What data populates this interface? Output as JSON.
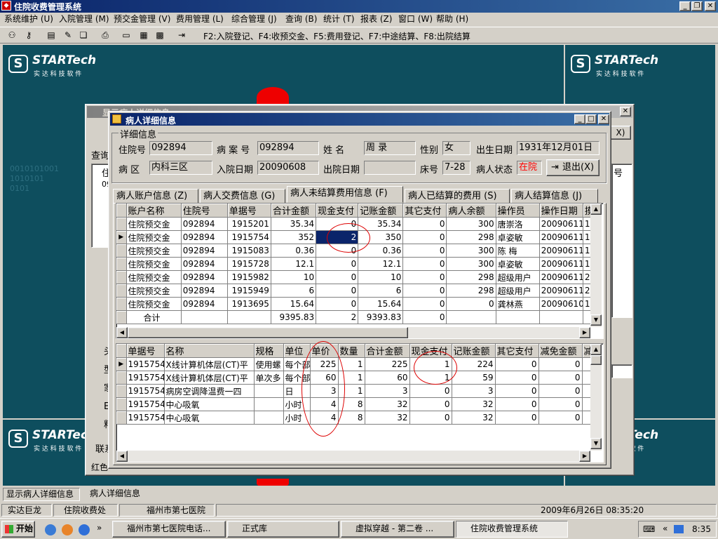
{
  "app": {
    "title": "住院收费管理系统",
    "menu": [
      "系统维护 (U)",
      "入院管理 (M)",
      "预交金管理 (V)",
      "费用管理 (L)",
      "综合管理 (J)",
      "查询 (B)",
      "统计 (T)",
      "报表 (Z)",
      "窗口 (W)",
      "帮助 (H)"
    ],
    "shortcuts": "F2:入院登记、F4:收预交金、F5:费用登记、F7:中途结算、F8:出院结算",
    "logo_text": "STARTech",
    "logo_sub": "实 达 科 技 软 件"
  },
  "back_dialog": {
    "title": "显示病人详细信息",
    "query_label": "查询",
    "col1": "住",
    "row1": "09",
    "left_labels": [
      "头",
      "型",
      "家",
      "E",
      "料",
      "联系"
    ],
    "footer": "红色",
    "close_hint": "X)",
    "right_col": "号"
  },
  "dialog": {
    "title": "病人详细信息",
    "group_label": "详细信息",
    "fields": {
      "inpatient_no_label": "住院号",
      "inpatient_no": "092894",
      "case_no_label": "病 案 号",
      "case_no": "092894",
      "name_label": "姓    名",
      "name": "周  录",
      "sex_label": "性别",
      "sex": "女",
      "birth_label": "出生日期",
      "birth": "1931年12月01日",
      "ward_label": "病  区",
      "ward": "内科三区",
      "admit_label": "入院日期",
      "admit": "20090608",
      "discharge_label": "出院日期",
      "discharge": "",
      "bed_label": "床号",
      "bed": "7-28",
      "status_label": "病人状态",
      "status": "在院",
      "exit_button": "退出(X)"
    },
    "tabs": [
      "病人账户信息 (Z)",
      "病人交费信息 (G)",
      "病人未结算费用信息 (F)",
      "病人已结算的费用 (S)",
      "病人结算信息 (J)"
    ],
    "grid1": {
      "headers": [
        "账户名称",
        "住院号",
        "单据号",
        "合计金额",
        "现金支付",
        "记账金额",
        "其它支付",
        "病人余额",
        "操作员",
        "操作日期",
        "摸"
      ],
      "rows": [
        [
          "住院预交金",
          "092894",
          "1915201",
          "35.34",
          "0",
          "35.34",
          "0",
          "300",
          "唐崇洛",
          "20090611",
          "1:"
        ],
        [
          "住院预交金",
          "092894",
          "1915754",
          "352",
          "2",
          "350",
          "0",
          "298",
          "卓姿敏",
          "20090611",
          "1!"
        ],
        [
          "住院预交金",
          "092894",
          "1915083",
          "0.36",
          "0",
          "0.36",
          "0",
          "300",
          "陈  梅",
          "20090611",
          "1("
        ],
        [
          "住院预交金",
          "092894",
          "1915728",
          "12.1",
          "0",
          "12.1",
          "0",
          "300",
          "卓姿敏",
          "20090611",
          "1!"
        ],
        [
          "住院预交金",
          "092894",
          "1915982",
          "10",
          "0",
          "10",
          "0",
          "298",
          "超级用户",
          "20090611",
          "2:"
        ],
        [
          "住院预交金",
          "092894",
          "1915949",
          "6",
          "0",
          "6",
          "0",
          "298",
          "超级用户",
          "20090611",
          "2:"
        ],
        [
          "住院预交金",
          "092894",
          "1913695",
          "15.64",
          "0",
          "15.64",
          "0",
          "0",
          "龚林燕",
          "20090610",
          "1:"
        ]
      ],
      "total": [
        "合计",
        "",
        "",
        "9395.83",
        "2",
        "9393.83",
        "0",
        "",
        "",
        "",
        ""
      ]
    },
    "grid2": {
      "headers": [
        "单据号",
        "名称",
        "规格",
        "单位",
        "单价",
        "数量",
        "合计金额",
        "现金支付",
        "记账金额",
        "其它支付",
        "减免金额",
        "减"
      ],
      "rows": [
        [
          "1915754",
          "X线计算机体层(CT)平",
          "使用螺",
          "每个部",
          "225",
          "1",
          "225",
          "1",
          "224",
          "0",
          "0",
          ""
        ],
        [
          "1915754",
          "X线计算机体层(CT)平",
          "单次多",
          "每个部",
          "60",
          "1",
          "60",
          "1",
          "59",
          "0",
          "0",
          ""
        ],
        [
          "1915754",
          "病房空调降温费一四",
          "",
          "日",
          "3",
          "1",
          "3",
          "0",
          "3",
          "0",
          "0",
          ""
        ],
        [
          "1915754",
          "中心吸氧",
          "",
          "小时",
          "4",
          "8",
          "32",
          "0",
          "32",
          "0",
          "0",
          ""
        ],
        [
          "1915754",
          "中心吸氧",
          "",
          "小时",
          "4",
          "8",
          "32",
          "0",
          "32",
          "0",
          "0",
          ""
        ]
      ]
    }
  },
  "mdi_tabs": [
    "显示病人详细信息",
    "病人详细信息"
  ],
  "statusbar": [
    "实达巨龙",
    "住院收费处",
    "福州市第七医院",
    "2009年6月26日  08:35:20"
  ],
  "taskbar": {
    "start": "开始",
    "items": [
      "福州市第七医院电话...",
      "正式库",
      "虚拟穿越 - 第二卷 ...",
      "住院收费管理系统"
    ],
    "clock": "8:35"
  },
  "colors": {
    "desktop": "#0e4e5e",
    "title_active": "#0a246a",
    "status_red": "#ff0000",
    "annotation": "#d00000"
  }
}
